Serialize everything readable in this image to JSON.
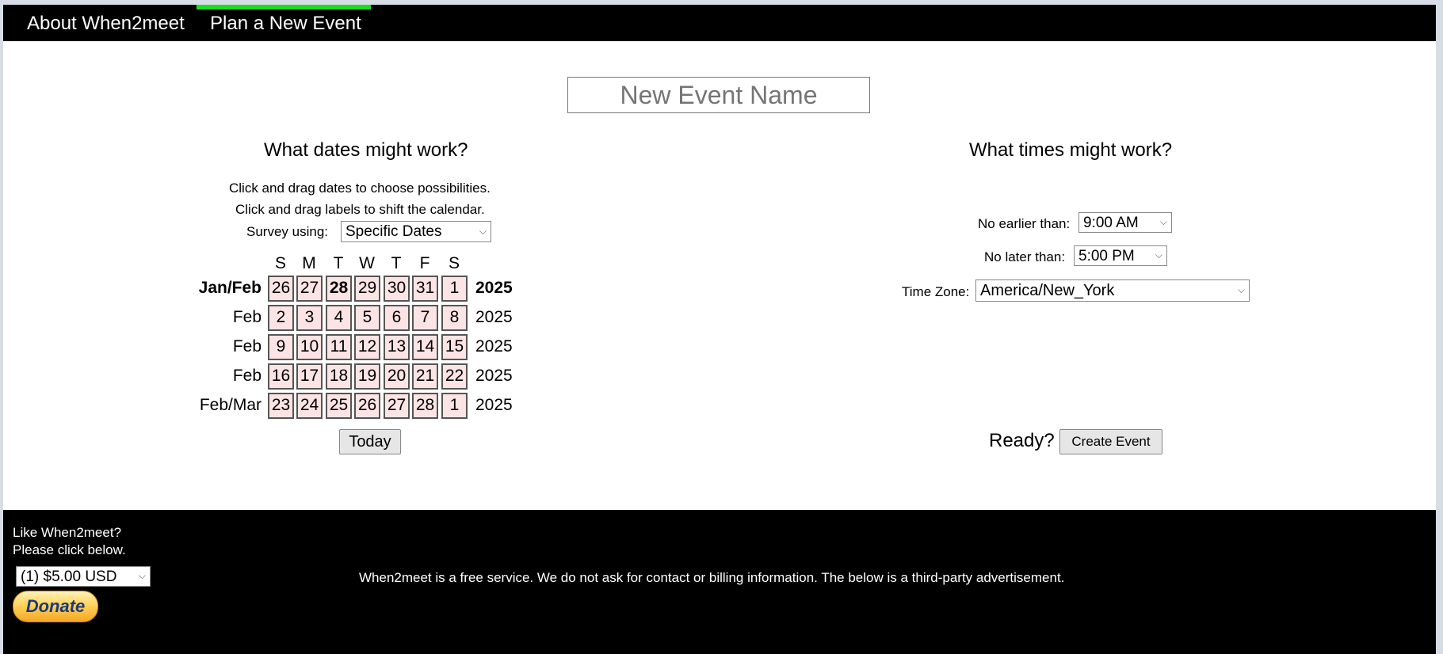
{
  "nav": {
    "about": "About When2meet",
    "plan": "Plan a New Event",
    "active_color": "#16e01e"
  },
  "event": {
    "name_placeholder": "New Event Name"
  },
  "dates": {
    "title": "What dates might work?",
    "instruction1": "Click and drag dates to choose possibilities.",
    "instruction2": "Click and drag labels to shift the calendar.",
    "survey_label": "Survey using:",
    "survey_value": "Specific Dates",
    "weekdays": [
      "S",
      "M",
      "T",
      "W",
      "T",
      "F",
      "S"
    ],
    "rows": [
      {
        "label": "Jan/Feb",
        "year": "2025",
        "bold": true,
        "days": [
          "26",
          "27",
          "28",
          "29",
          "30",
          "31",
          "1"
        ]
      },
      {
        "label": "Feb",
        "year": "2025",
        "bold": false,
        "days": [
          "2",
          "3",
          "4",
          "5",
          "6",
          "7",
          "8"
        ]
      },
      {
        "label": "Feb",
        "year": "2025",
        "bold": false,
        "days": [
          "9",
          "10",
          "11",
          "12",
          "13",
          "14",
          "15"
        ]
      },
      {
        "label": "Feb",
        "year": "2025",
        "bold": false,
        "days": [
          "16",
          "17",
          "18",
          "19",
          "20",
          "21",
          "22"
        ]
      },
      {
        "label": "Feb/Mar",
        "year": "2025",
        "bold": false,
        "days": [
          "23",
          "24",
          "25",
          "26",
          "27",
          "28",
          "1"
        ]
      }
    ],
    "today_day": "28",
    "today_button": "Today",
    "day_cell_color": "#fde4e4"
  },
  "times": {
    "title": "What times might work?",
    "earliest_label": "No earlier than:",
    "earliest_value": "9:00 AM",
    "latest_label": "No later than:",
    "latest_value": "5:00 PM",
    "timezone_label": "Time Zone:",
    "timezone_value": "America/New_York"
  },
  "ready": {
    "label": "Ready?",
    "button": "Create Event"
  },
  "footer": {
    "like_line1": "Like When2meet?",
    "like_line2": "Please click below.",
    "donate_option": "(1) $5.00 USD",
    "donate_button": "Donate",
    "free_service": "When2meet is a free service. We do not ask for contact or billing information. The below is a third-party advertisement."
  }
}
